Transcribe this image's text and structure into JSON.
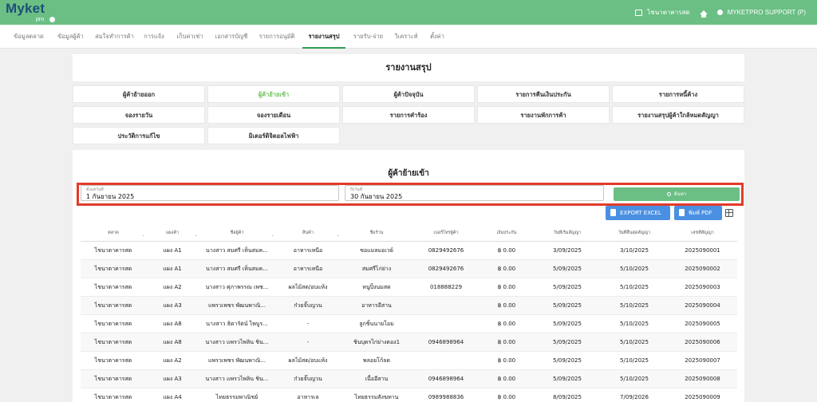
{
  "app": {
    "logo_main": "Myket",
    "logo_sub": "pro",
    "market_name": "ไชนาตาคารสด",
    "user_label": "MYKETPRO SUPPORT (P)"
  },
  "nav": {
    "tabs": [
      {
        "label": "ข้อมูลตลาด"
      },
      {
        "label": "ข้อมูลผู้ค้า"
      },
      {
        "label": "สมใจทำการค้า"
      },
      {
        "label": "การแจ้ง"
      },
      {
        "label": "เก็บค่าเช่า"
      },
      {
        "label": "เอกสารบัญชี"
      },
      {
        "label": "รายการอนุมัติ"
      },
      {
        "label": "รายงานสรุป"
      },
      {
        "label": "รายรับ-จ่าย"
      },
      {
        "label": "วิเคราะห์"
      },
      {
        "label": "ตั้งค่า"
      }
    ],
    "active_index": 7
  },
  "page_title": "รายงานสรุป",
  "report_buttons": [
    {
      "label": "ผู้ค้าย้ายออก"
    },
    {
      "label": "ผู้ค้าย้ายเข้า"
    },
    {
      "label": "ผู้ค้าปัจจุบัน"
    },
    {
      "label": "รายการคืนเงินประกัน"
    },
    {
      "label": "รายการหนี้ค้าง"
    },
    {
      "label": "จองรายวัน"
    },
    {
      "label": "จองรายเดือน"
    },
    {
      "label": "รายการคำร้อง"
    },
    {
      "label": "รายงานพักการค้า"
    },
    {
      "label": "รายงานสรุปผู้ค้าใกล้หมดสัญญา"
    },
    {
      "label": "ประวัติการแก้ไข"
    },
    {
      "label": "มิเตอร์ดิจิตอลไฟฟ้า"
    }
  ],
  "active_report_index": 1,
  "filter": {
    "section_title": "ผู้ค้าย้ายเข้า",
    "start_label": "ตั้งแต่วันที่",
    "start_value": "1 กันยายน 2025",
    "end_label": "ถึงวันที่",
    "end_value": "30 กันยายน 2025",
    "search_label": "ค้นหา",
    "export_excel": "EXPORT EXCEL",
    "export_pdf": "พิมพ์ PDF"
  },
  "table": {
    "columns": [
      "ตลาด",
      "แผงค้า",
      "ชื่อผู้ค้า",
      "สินค้า",
      "ชื่อร้าน",
      "เบอร์โทรผู้ค้า",
      "เงินประกัน",
      "วันที่เริ่มสัญญา",
      "วันที่สิ้นสุดสัญญา",
      "เลขที่สัญญา"
    ],
    "rows": [
      [
        "ไชนาตาคารสด",
        "แผง A1",
        "นางสาว สมศรี เห็นสมค...",
        "อาหารเหนือ",
        "ซอแมลมอเวย์",
        "0829492676",
        "฿ 0.00",
        "3/09/2025",
        "3/10/2025",
        "2025090001"
      ],
      [
        "ไชนาตาคารสด",
        "แผง A1",
        "นางสาว สมศรี เห็นสมค...",
        "อาหารเหนือ",
        "สมศรีไก่ย่าง",
        "0829492676",
        "฿ 0.00",
        "5/09/2025",
        "5/10/2025",
        "2025090002"
      ],
      [
        "ไชนาตาคารสด",
        "แผง A2",
        "นางสาว ศุภาพรรณ เพช...",
        "ผลไม้สด/อบแห้ง",
        "หนูปิ้งนมสด",
        "018888229",
        "฿ 0.00",
        "5/09/2025",
        "5/10/2025",
        "2025090003"
      ],
      [
        "ไชนาตาคารสด",
        "แผง A3",
        "แพรวเพชร พัฒนพาณิ...",
        "ก๋วยจั๊บญวน",
        "อาหารอีสาน",
        "",
        "฿ 0.00",
        "5/09/2025",
        "5/10/2025",
        "2025090004"
      ],
      [
        "ไชนาตาคารสด",
        "แผง A8",
        "นางสาว ธิดารัตน์ ไพบูร...",
        "-",
        "ลูกชิ้นนายโอม",
        "",
        "฿ 0.00",
        "5/09/2025",
        "5/10/2025",
        "2025090005"
      ],
      [
        "ไชนาตาคารสด",
        "แผง A8",
        "นางสาว แพรวไพลิน ชิน...",
        "-",
        "ชินบุตรไก่ย่างตอง1",
        "0946898964",
        "฿ 0.00",
        "5/09/2025",
        "5/10/2025",
        "2025090006"
      ],
      [
        "ไชนาตาคารสด",
        "แผง A2",
        "แพรวเพชร พัฒนพาณิ...",
        "ผลไม้สด/อบแห้ง",
        "พลอยโก้ลด",
        "",
        "฿ 0.00",
        "5/09/2025",
        "5/10/2025",
        "2025090007"
      ],
      [
        "ไชนาตาคารสด",
        "แผง A3",
        "นางสาว แพรวไพลิน ชิน...",
        "ก๋วยจั๊บญวน",
        "เนื้ออีสาน",
        "0946898964",
        "฿ 0.00",
        "5/09/2025",
        "5/10/2025",
        "2025090008"
      ],
      [
        "ไชนาตาคารสด",
        "แผง A4",
        "ไทยธรรมพาณิชย์",
        "อาหารเล",
        "ไทยธรรมสังฆทาน",
        "0989988836",
        "฿ 0.00",
        "8/09/2025",
        "7/09/2026",
        "2025090009"
      ]
    ]
  }
}
